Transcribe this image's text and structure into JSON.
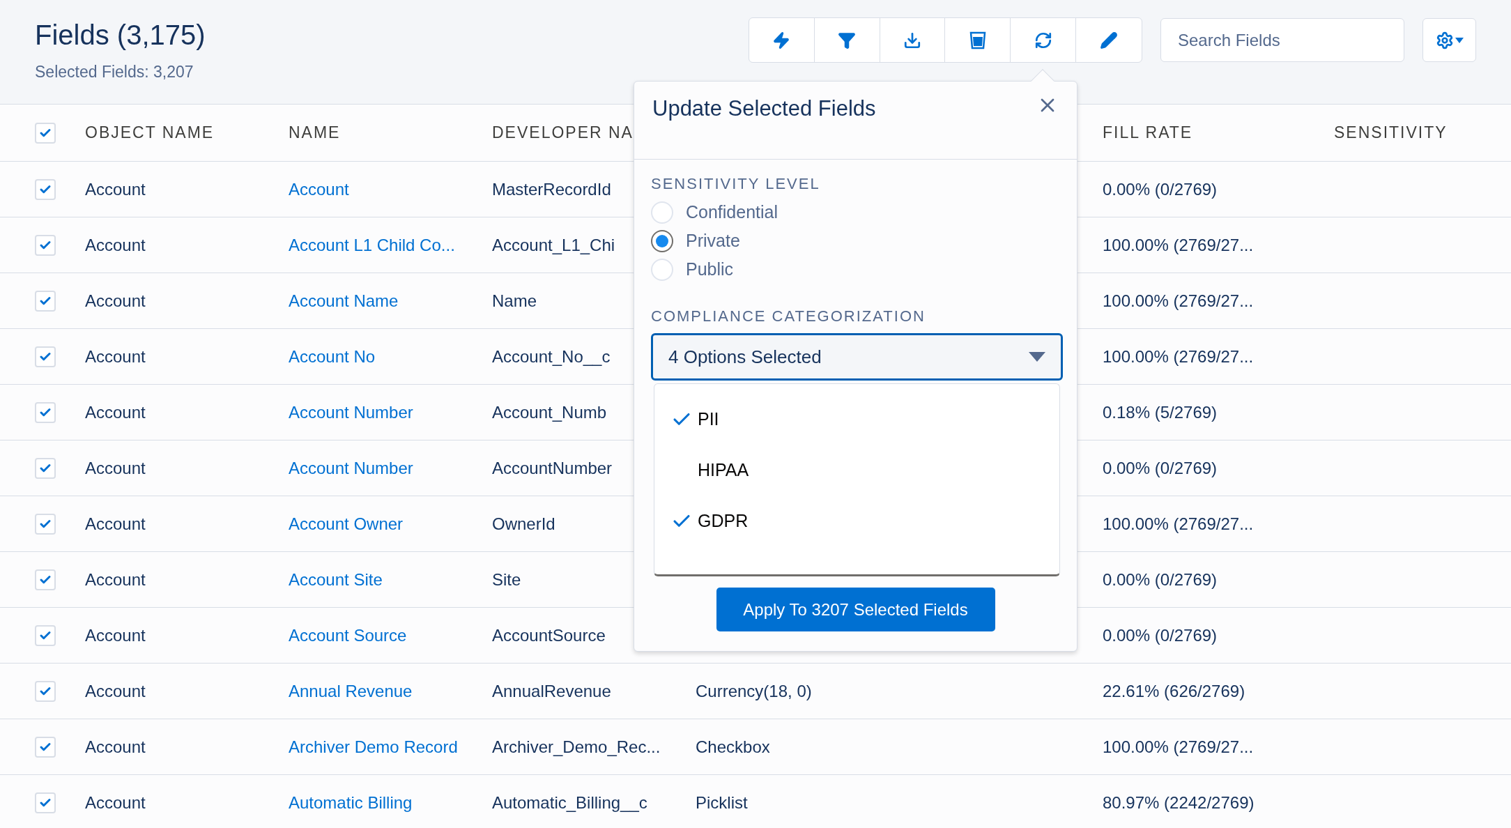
{
  "header": {
    "title": "Fields (3,175)",
    "subtitle": "Selected Fields: 3,207"
  },
  "search": {
    "placeholder": "Search Fields"
  },
  "table": {
    "select_all_checked": true,
    "columns": [
      {
        "label": "OBJECT NAME"
      },
      {
        "label": "NAME"
      },
      {
        "label": "DEVELOPER NA"
      },
      {
        "label": "FILL RATE"
      },
      {
        "label": "SENSITIVITY"
      }
    ],
    "rows": [
      {
        "checked": true,
        "object_name": "Account",
        "name": "Account",
        "developer_name": "MasterRecordId",
        "fill_rate": "0.00% (0/2769)"
      },
      {
        "checked": true,
        "object_name": "Account",
        "name": "Account L1 Child Co...",
        "developer_name": "Account_L1_Chi",
        "fill_rate": "100.00% (2769/27..."
      },
      {
        "checked": true,
        "object_name": "Account",
        "name": "Account Name",
        "developer_name": "Name",
        "fill_rate": "100.00% (2769/27..."
      },
      {
        "checked": true,
        "object_name": "Account",
        "name": "Account No",
        "developer_name": "Account_No__c",
        "fill_rate": "100.00% (2769/27..."
      },
      {
        "checked": true,
        "object_name": "Account",
        "name": "Account Number",
        "developer_name": "Account_Numb",
        "fill_rate": "0.18% (5/2769)"
      },
      {
        "checked": true,
        "object_name": "Account",
        "name": "Account Number",
        "developer_name": "AccountNumber",
        "fill_rate": "0.00% (0/2769)"
      },
      {
        "checked": true,
        "object_name": "Account",
        "name": "Account Owner",
        "developer_name": "OwnerId",
        "fill_rate": "100.00% (2769/27..."
      },
      {
        "checked": true,
        "object_name": "Account",
        "name": "Account Site",
        "developer_name": "Site",
        "fill_rate": "0.00% (0/2769)"
      },
      {
        "checked": true,
        "object_name": "Account",
        "name": "Account Source",
        "developer_name": "AccountSource",
        "fill_rate": "0.00% (0/2769)"
      },
      {
        "checked": true,
        "object_name": "Account",
        "name": "Annual Revenue",
        "developer_name": "AnnualRevenue",
        "column_4": "Currency(18, 0)",
        "fill_rate": "22.61% (626/2769)"
      },
      {
        "checked": true,
        "object_name": "Account",
        "name": "Archiver Demo Record",
        "developer_name": "Archiver_Demo_Rec...",
        "column_4": "Checkbox",
        "fill_rate": "100.00% (2769/27..."
      },
      {
        "checked": true,
        "object_name": "Account",
        "name": "Automatic Billing",
        "developer_name": "Automatic_Billing__c",
        "column_4": "Picklist",
        "fill_rate": "80.97% (2242/2769)"
      }
    ]
  },
  "popup": {
    "title": "Update Selected Fields",
    "sensitivity_level": {
      "label": "SENSITIVITY LEVEL",
      "options": [
        {
          "label": "Confidential",
          "selected": false
        },
        {
          "label": "Private",
          "selected": true
        },
        {
          "label": "Public",
          "selected": false
        }
      ]
    },
    "compliance": {
      "label": "COMPLIANCE CATEGORIZATION",
      "value": "4 Options Selected",
      "expanded": true,
      "options": [
        {
          "label": "PII",
          "checked": true
        },
        {
          "label": "HIPAA",
          "checked": false
        },
        {
          "label": "GDPR",
          "checked": true
        }
      ]
    },
    "apply_button": "Apply To 3207 Selected Fields"
  }
}
